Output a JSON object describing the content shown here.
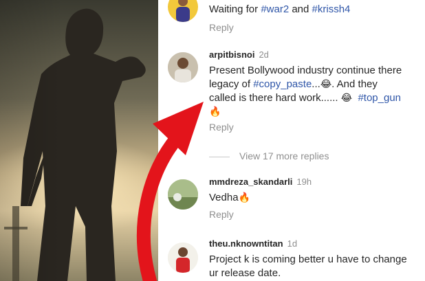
{
  "comments": [
    {
      "username": "",
      "time": "",
      "text_parts": [
        "Waiting for ",
        "#war2",
        " and ",
        "#krissh4"
      ],
      "reply": "Reply"
    },
    {
      "username": "arpitbisnoi",
      "time": "2d",
      "line1": "Present Bollywood industry continue there",
      "line2_pre": "legacy of ",
      "line2_tag": "#copy_paste",
      "line2_post": "...",
      "line2_end": ". And they",
      "line3_pre": "called is there hard work...... ",
      "line3_tag": "#top_gun",
      "reply": "Reply"
    },
    {
      "username": "mmdreza_skandarli",
      "time": "19h",
      "text": "Vedha",
      "reply": "Reply"
    },
    {
      "username": "theu.nknowntitan",
      "time": "1d",
      "line1": "Project k is coming better u have to change",
      "line2": "ur release date."
    }
  ],
  "view_more": "View 17 more replies",
  "icons": {
    "laugh": "face-with-tears-of-joy-icon",
    "fire": "fire-icon"
  },
  "colors": {
    "hashtag": "#2f56a8",
    "arrow": "#e3141b"
  }
}
